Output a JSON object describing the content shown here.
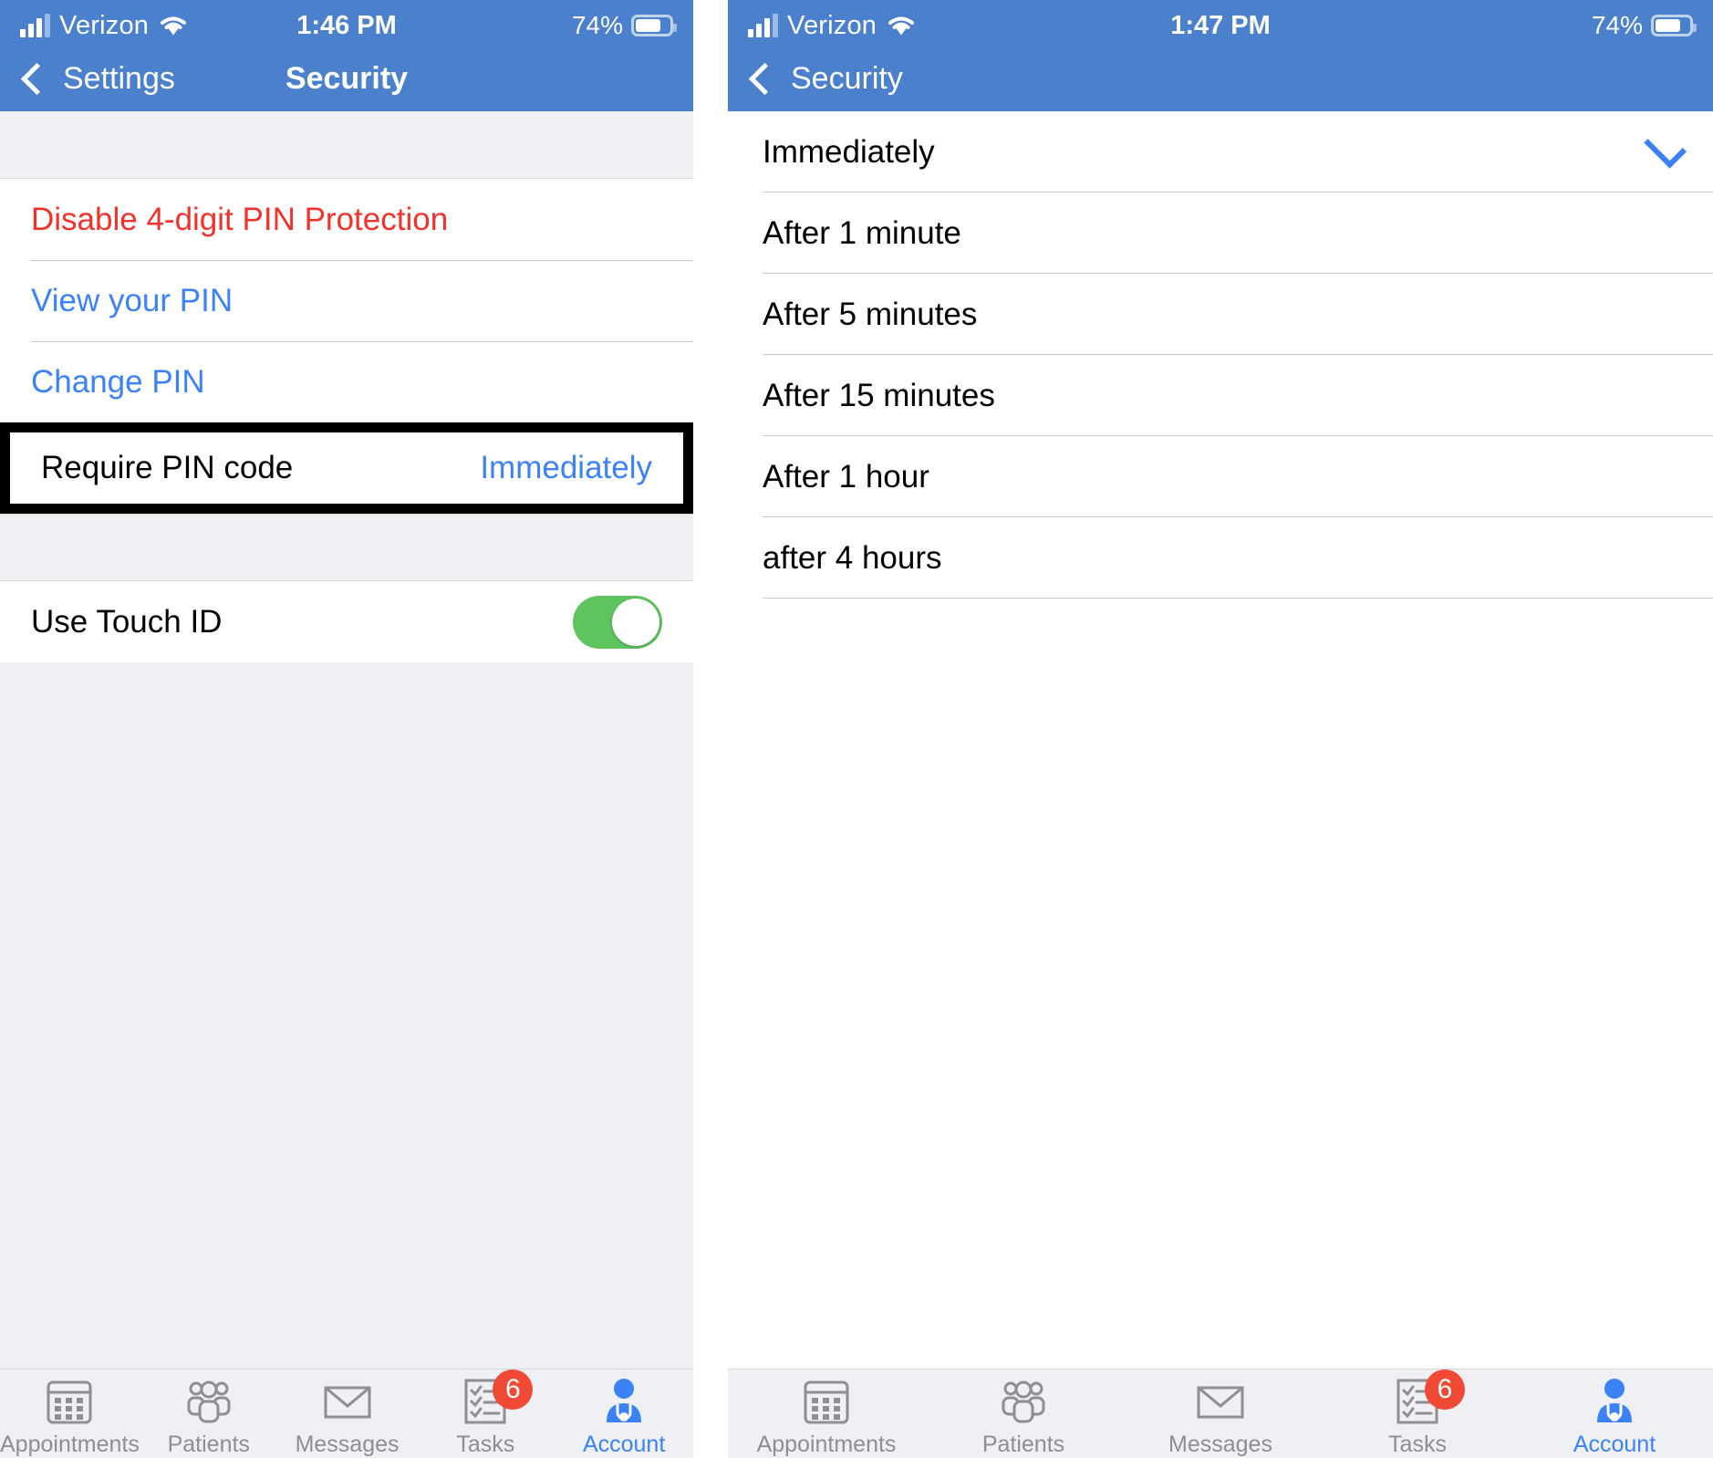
{
  "left": {
    "status": {
      "carrier": "Verizon",
      "time": "1:46 PM",
      "battery": "74%",
      "signal_icon": "cellular-bars-icon",
      "wifi_icon": "wifi-icon",
      "battery_icon": "battery-icon"
    },
    "nav": {
      "back_label": "Settings",
      "title": "Security",
      "back_icon": "chevron-left-icon"
    },
    "rows": [
      {
        "label": "Disable 4-digit PIN Protection",
        "style": "destructive"
      },
      {
        "label": "View your PIN",
        "style": "link"
      },
      {
        "label": "Change PIN",
        "style": "link"
      },
      {
        "label": "Require PIN code",
        "style": "plain",
        "value": "Immediately",
        "highlighted": true
      }
    ],
    "touch_id": {
      "label": "Use Touch ID",
      "toggle_state": "on",
      "toggle_color": "#5ec45e"
    }
  },
  "right": {
    "status": {
      "carrier": "Verizon",
      "time": "1:47 PM",
      "battery": "74%",
      "signal_icon": "cellular-bars-icon",
      "wifi_icon": "wifi-icon",
      "battery_icon": "battery-icon"
    },
    "nav": {
      "back_label": "Security",
      "back_icon": "chevron-left-icon"
    },
    "options": [
      {
        "label": "Immediately",
        "selected": true
      },
      {
        "label": "After 1 minute",
        "selected": false
      },
      {
        "label": "After 5 minutes",
        "selected": false
      },
      {
        "label": "After 15 minutes",
        "selected": false
      },
      {
        "label": "After 1 hour",
        "selected": false
      },
      {
        "label": "after 4 hours",
        "selected": false
      }
    ],
    "check_icon": "checkmark-icon"
  },
  "tabbar": {
    "tabs": [
      {
        "label": "Appointments",
        "icon": "calendar-icon",
        "active": false,
        "badge": null
      },
      {
        "label": "Patients",
        "icon": "people-icon",
        "active": false,
        "badge": null
      },
      {
        "label": "Messages",
        "icon": "envelope-icon",
        "active": false,
        "badge": null
      },
      {
        "label": "Tasks",
        "icon": "checklist-icon",
        "active": false,
        "badge": "6"
      },
      {
        "label": "Account",
        "icon": "doctor-icon",
        "active": true,
        "badge": null
      }
    ],
    "active_color": "#3b82f6",
    "inactive_color": "#8e8e93",
    "badge_color": "#f04a37"
  },
  "theme": {
    "nav_blue": "#4a80cc",
    "link_blue": "#3b82f6",
    "destructive_red": "#f2322a",
    "group_bg": "#eff0f4"
  }
}
